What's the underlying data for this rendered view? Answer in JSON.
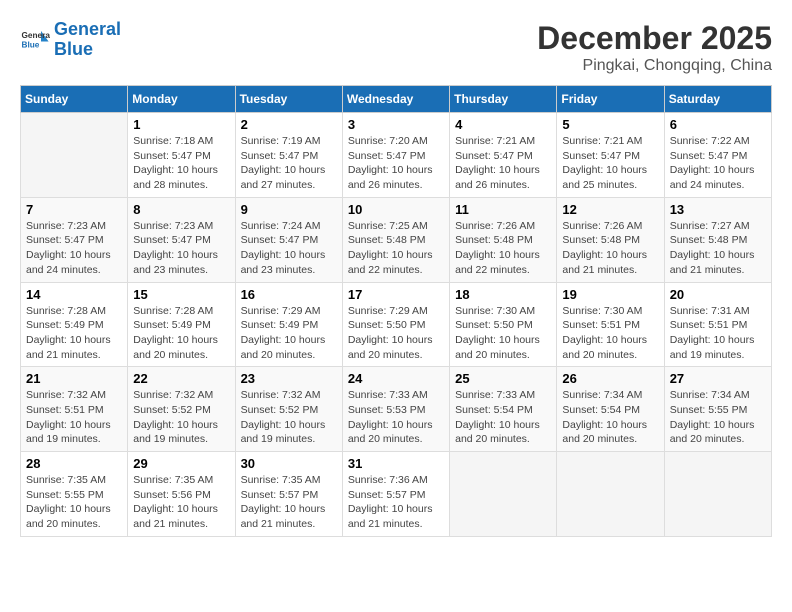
{
  "logo": {
    "line1": "General",
    "line2": "Blue"
  },
  "title": "December 2025",
  "subtitle": "Pingkai, Chongqing, China",
  "weekdays": [
    "Sunday",
    "Monday",
    "Tuesday",
    "Wednesday",
    "Thursday",
    "Friday",
    "Saturday"
  ],
  "weeks": [
    [
      {
        "day": null,
        "info": null
      },
      {
        "day": "1",
        "info": "Sunrise: 7:18 AM\nSunset: 5:47 PM\nDaylight: 10 hours\nand 28 minutes."
      },
      {
        "day": "2",
        "info": "Sunrise: 7:19 AM\nSunset: 5:47 PM\nDaylight: 10 hours\nand 27 minutes."
      },
      {
        "day": "3",
        "info": "Sunrise: 7:20 AM\nSunset: 5:47 PM\nDaylight: 10 hours\nand 26 minutes."
      },
      {
        "day": "4",
        "info": "Sunrise: 7:21 AM\nSunset: 5:47 PM\nDaylight: 10 hours\nand 26 minutes."
      },
      {
        "day": "5",
        "info": "Sunrise: 7:21 AM\nSunset: 5:47 PM\nDaylight: 10 hours\nand 25 minutes."
      },
      {
        "day": "6",
        "info": "Sunrise: 7:22 AM\nSunset: 5:47 PM\nDaylight: 10 hours\nand 24 minutes."
      }
    ],
    [
      {
        "day": "7",
        "info": "Sunrise: 7:23 AM\nSunset: 5:47 PM\nDaylight: 10 hours\nand 24 minutes."
      },
      {
        "day": "8",
        "info": "Sunrise: 7:23 AM\nSunset: 5:47 PM\nDaylight: 10 hours\nand 23 minutes."
      },
      {
        "day": "9",
        "info": "Sunrise: 7:24 AM\nSunset: 5:47 PM\nDaylight: 10 hours\nand 23 minutes."
      },
      {
        "day": "10",
        "info": "Sunrise: 7:25 AM\nSunset: 5:48 PM\nDaylight: 10 hours\nand 22 minutes."
      },
      {
        "day": "11",
        "info": "Sunrise: 7:26 AM\nSunset: 5:48 PM\nDaylight: 10 hours\nand 22 minutes."
      },
      {
        "day": "12",
        "info": "Sunrise: 7:26 AM\nSunset: 5:48 PM\nDaylight: 10 hours\nand 21 minutes."
      },
      {
        "day": "13",
        "info": "Sunrise: 7:27 AM\nSunset: 5:48 PM\nDaylight: 10 hours\nand 21 minutes."
      }
    ],
    [
      {
        "day": "14",
        "info": "Sunrise: 7:28 AM\nSunset: 5:49 PM\nDaylight: 10 hours\nand 21 minutes."
      },
      {
        "day": "15",
        "info": "Sunrise: 7:28 AM\nSunset: 5:49 PM\nDaylight: 10 hours\nand 20 minutes."
      },
      {
        "day": "16",
        "info": "Sunrise: 7:29 AM\nSunset: 5:49 PM\nDaylight: 10 hours\nand 20 minutes."
      },
      {
        "day": "17",
        "info": "Sunrise: 7:29 AM\nSunset: 5:50 PM\nDaylight: 10 hours\nand 20 minutes."
      },
      {
        "day": "18",
        "info": "Sunrise: 7:30 AM\nSunset: 5:50 PM\nDaylight: 10 hours\nand 20 minutes."
      },
      {
        "day": "19",
        "info": "Sunrise: 7:30 AM\nSunset: 5:51 PM\nDaylight: 10 hours\nand 20 minutes."
      },
      {
        "day": "20",
        "info": "Sunrise: 7:31 AM\nSunset: 5:51 PM\nDaylight: 10 hours\nand 19 minutes."
      }
    ],
    [
      {
        "day": "21",
        "info": "Sunrise: 7:32 AM\nSunset: 5:51 PM\nDaylight: 10 hours\nand 19 minutes."
      },
      {
        "day": "22",
        "info": "Sunrise: 7:32 AM\nSunset: 5:52 PM\nDaylight: 10 hours\nand 19 minutes."
      },
      {
        "day": "23",
        "info": "Sunrise: 7:32 AM\nSunset: 5:52 PM\nDaylight: 10 hours\nand 19 minutes."
      },
      {
        "day": "24",
        "info": "Sunrise: 7:33 AM\nSunset: 5:53 PM\nDaylight: 10 hours\nand 20 minutes."
      },
      {
        "day": "25",
        "info": "Sunrise: 7:33 AM\nSunset: 5:54 PM\nDaylight: 10 hours\nand 20 minutes."
      },
      {
        "day": "26",
        "info": "Sunrise: 7:34 AM\nSunset: 5:54 PM\nDaylight: 10 hours\nand 20 minutes."
      },
      {
        "day": "27",
        "info": "Sunrise: 7:34 AM\nSunset: 5:55 PM\nDaylight: 10 hours\nand 20 minutes."
      }
    ],
    [
      {
        "day": "28",
        "info": "Sunrise: 7:35 AM\nSunset: 5:55 PM\nDaylight: 10 hours\nand 20 minutes."
      },
      {
        "day": "29",
        "info": "Sunrise: 7:35 AM\nSunset: 5:56 PM\nDaylight: 10 hours\nand 21 minutes."
      },
      {
        "day": "30",
        "info": "Sunrise: 7:35 AM\nSunset: 5:57 PM\nDaylight: 10 hours\nand 21 minutes."
      },
      {
        "day": "31",
        "info": "Sunrise: 7:36 AM\nSunset: 5:57 PM\nDaylight: 10 hours\nand 21 minutes."
      },
      {
        "day": null,
        "info": null
      },
      {
        "day": null,
        "info": null
      },
      {
        "day": null,
        "info": null
      }
    ]
  ]
}
